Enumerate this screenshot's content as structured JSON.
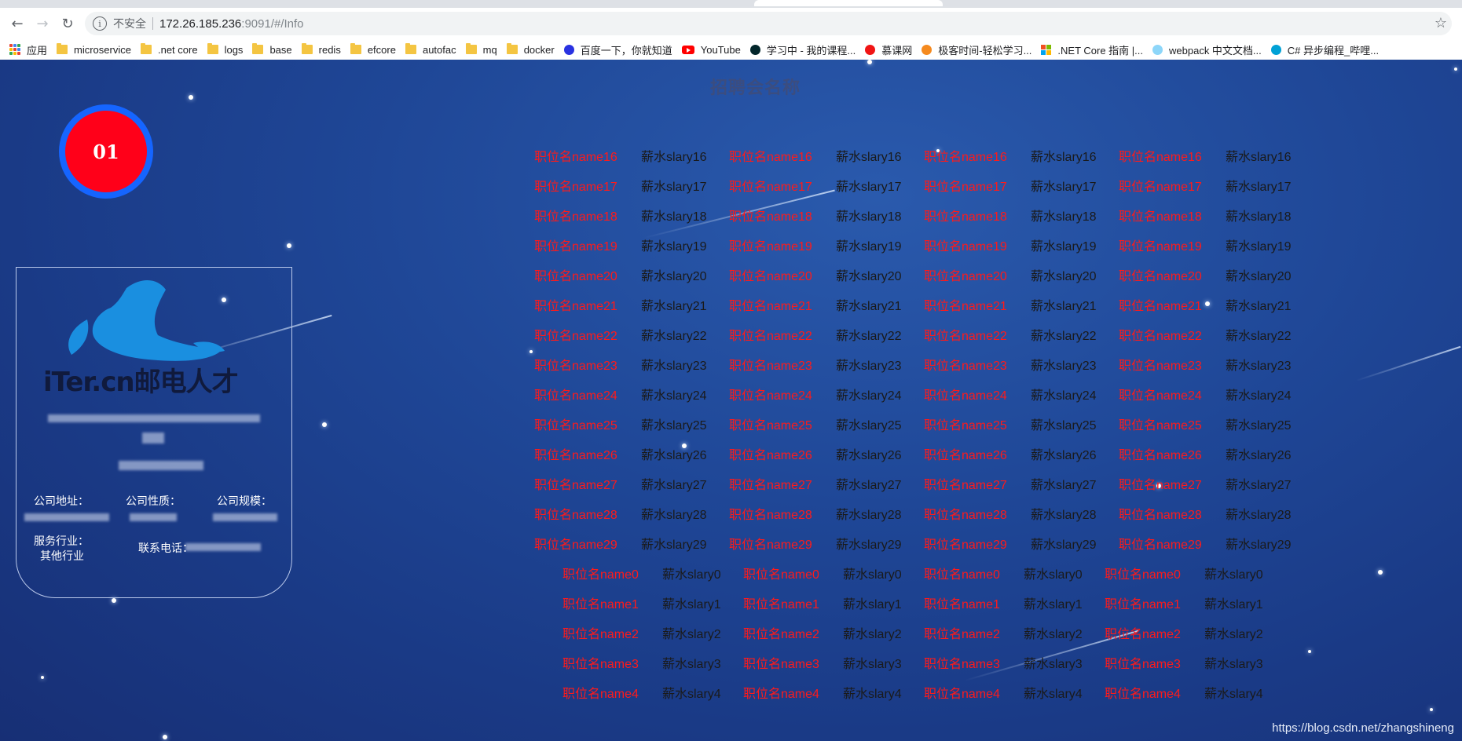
{
  "browser": {
    "insecure_label": "不安全",
    "url_host": "172.26.185.236",
    "url_path": ":9091/#/Info",
    "bookmarks": [
      {
        "label": "应用",
        "icon": "apps-grid-icon"
      },
      {
        "label": "microservice",
        "icon": "folder-icon"
      },
      {
        "label": ".net core",
        "icon": "folder-icon"
      },
      {
        "label": "logs",
        "icon": "folder-icon"
      },
      {
        "label": "base",
        "icon": "folder-icon"
      },
      {
        "label": "redis",
        "icon": "folder-icon"
      },
      {
        "label": "efcore",
        "icon": "folder-icon"
      },
      {
        "label": "autofac",
        "icon": "folder-icon"
      },
      {
        "label": "mq",
        "icon": "folder-icon"
      },
      {
        "label": "docker",
        "icon": "folder-icon"
      },
      {
        "label": "百度一下，你就知道",
        "icon": "baidu-icon"
      },
      {
        "label": "YouTube",
        "icon": "youtube-icon"
      },
      {
        "label": "学习中 - 我的课程...",
        "icon": "edx-icon"
      },
      {
        "label": "慕课网",
        "icon": "imooc-icon"
      },
      {
        "label": "极客时间-轻松学习...",
        "icon": "geekbang-icon"
      },
      {
        "label": ".NET Core 指南 |...",
        "icon": "microsoft-icon"
      },
      {
        "label": "webpack 中文文档...",
        "icon": "webpack-icon"
      },
      {
        "label": "C# 异步编程_哔哩...",
        "icon": "bilibili-icon"
      }
    ]
  },
  "page": {
    "fair_title": "招聘会名称",
    "booth_number": "01",
    "company": {
      "logo_text": "iTer.cn邮电人才",
      "address_label": "公司地址：",
      "nature_label": "公司性质：",
      "scale_label": "公司规模：",
      "industry_label": "服务行业：",
      "industry_value": "其他行业",
      "phone_label": "联系电话："
    },
    "jobs_a": [
      {
        "name": "职位名name16",
        "salary": "薪水slary16"
      },
      {
        "name": "职位名name17",
        "salary": "薪水slary17"
      },
      {
        "name": "职位名name18",
        "salary": "薪水slary18"
      },
      {
        "name": "职位名name19",
        "salary": "薪水slary19"
      },
      {
        "name": "职位名name20",
        "salary": "薪水slary20"
      },
      {
        "name": "职位名name21",
        "salary": "薪水slary21"
      },
      {
        "name": "职位名name22",
        "salary": "薪水slary22"
      },
      {
        "name": "职位名name23",
        "salary": "薪水slary23"
      },
      {
        "name": "职位名name24",
        "salary": "薪水slary24"
      },
      {
        "name": "职位名name25",
        "salary": "薪水slary25"
      },
      {
        "name": "职位名name26",
        "salary": "薪水slary26"
      },
      {
        "name": "职位名name27",
        "salary": "薪水slary27"
      },
      {
        "name": "职位名name28",
        "salary": "薪水slary28"
      },
      {
        "name": "职位名name29",
        "salary": "薪水slary29"
      }
    ],
    "jobs_b": [
      {
        "name": "职位名name0",
        "salary": "薪水slary0"
      },
      {
        "name": "职位名name1",
        "salary": "薪水slary1"
      },
      {
        "name": "职位名name2",
        "salary": "薪水slary2"
      },
      {
        "name": "职位名name3",
        "salary": "薪水slary3"
      },
      {
        "name": "职位名name4",
        "salary": "薪水slary4"
      }
    ],
    "columns_per_row": 4,
    "watermark": "https://blog.csdn.net/zhangshineng"
  },
  "colors": {
    "job_name": "#ff1a1a",
    "job_salary": "#1a1a1a",
    "badge_ring": "#1565ff",
    "badge_fill": "#ff0019"
  }
}
